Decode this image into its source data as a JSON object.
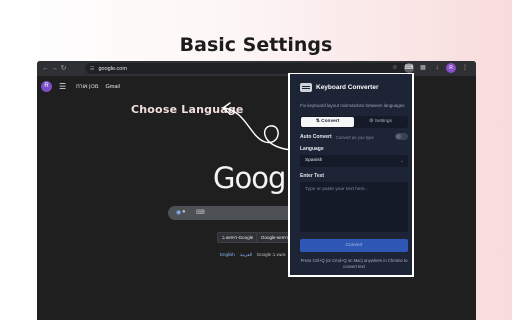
{
  "promo": {
    "title": "Basic Settings",
    "annotation": "Choose Language"
  },
  "browser": {
    "url": "google.com",
    "avatar_letter": "R",
    "profile_letter": "R",
    "nav_links": [
      "מכון אורח",
      "Gmail"
    ],
    "google_logo": "Google",
    "buttons": [
      "חיפוש ב-Google",
      "Google-ב חיפוש"
    ],
    "languages_prefix": "English",
    "languages_arabic": "العربية",
    "languages_text": "Google מוצע ב"
  },
  "popup": {
    "title": "Keyboard Converter",
    "description": "Fix keyboard layout mismatches between languages",
    "tab_convert": "Convert",
    "tab_settings": "Settings",
    "auto_convert_label": "Auto Convert",
    "auto_convert_hint": "Convert as you type",
    "auto_convert_on": false,
    "language_label": "Language",
    "language_value": "Spanish",
    "enter_text_label": "Enter Text",
    "textarea_placeholder": "Type or paste your text here...",
    "convert_button": "Convert",
    "footer": "Press Ctrl+Q (or Cmd+Q on Mac) anywhere in Chrome to convert text"
  },
  "colors": {
    "accent": "#2f57b6",
    "popup_bg": "#1d2436",
    "page_bg": "#1f1f1f"
  }
}
